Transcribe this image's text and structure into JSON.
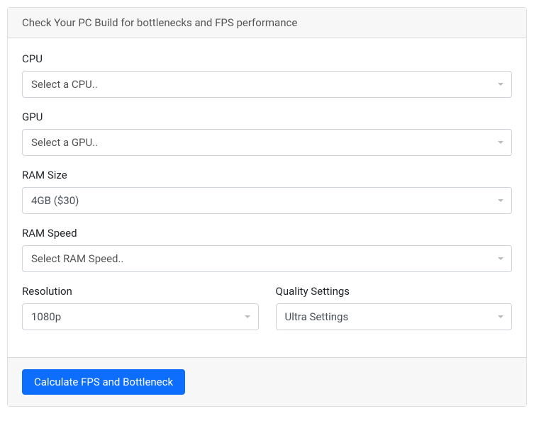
{
  "header": {
    "title": "Check Your PC Build for bottlenecks and FPS performance"
  },
  "form": {
    "cpu": {
      "label": "CPU",
      "value": "Select a CPU.."
    },
    "gpu": {
      "label": "GPU",
      "value": "Select a GPU.."
    },
    "ram_size": {
      "label": "RAM Size",
      "value": "4GB ($30)"
    },
    "ram_speed": {
      "label": "RAM Speed",
      "value": "Select RAM Speed.."
    },
    "resolution": {
      "label": "Resolution",
      "value": "1080p"
    },
    "quality": {
      "label": "Quality Settings",
      "value": "Ultra Settings"
    }
  },
  "footer": {
    "button_label": "Calculate FPS and Bottleneck"
  }
}
